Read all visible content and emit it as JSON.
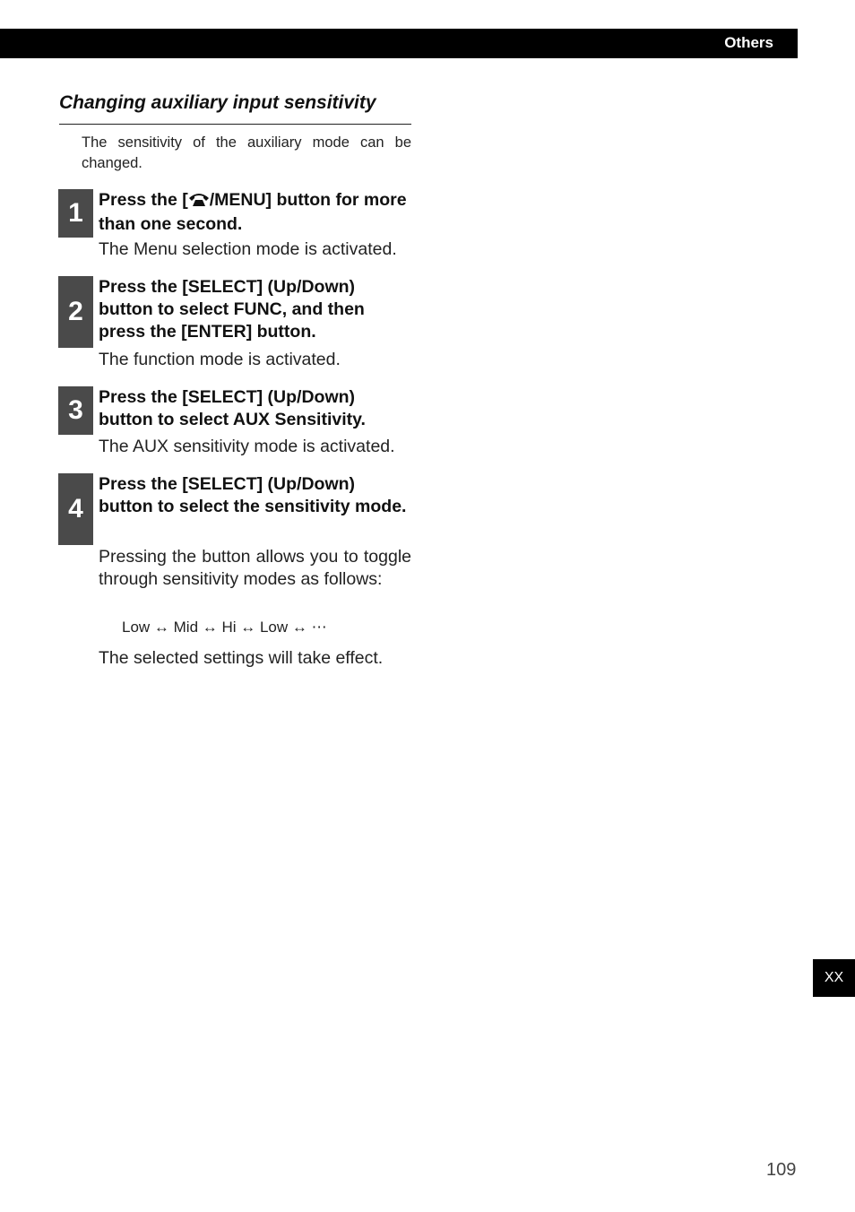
{
  "header": {
    "section": "Others"
  },
  "title": "Changing auxiliary input sensitivity",
  "intro": "The sensitivity of the auxiliary mode can be changed.",
  "steps": [
    {
      "number": "1",
      "head_before_icon": "Press the [",
      "icon": "phone-handset-icon",
      "head_after_icon": "/MENU] button for more than one second.",
      "body": "The Menu selection mode is activated."
    },
    {
      "number": "2",
      "head": "Press the [SELECT] (Up/Down) button to select FUNC, and then press the [ENTER] button.",
      "body": "The function mode is activated."
    },
    {
      "number": "3",
      "head": "Press the [SELECT] (Up/Down) button to select AUX Sensitivity.",
      "body": "The AUX sensitivity mode is activated."
    },
    {
      "number": "4",
      "head": "Press the [SELECT] (Up/Down) button to select the sensitivity mode.",
      "body": "Pressing the button allows you to toggle through sensitivity modes as follows:"
    }
  ],
  "sequence": "Low ↔ Mid ↔ Hi ↔ Low ↔ ⋯",
  "final_note": "The selected settings will take effect.",
  "language_tab": "XX",
  "page_number": "109"
}
